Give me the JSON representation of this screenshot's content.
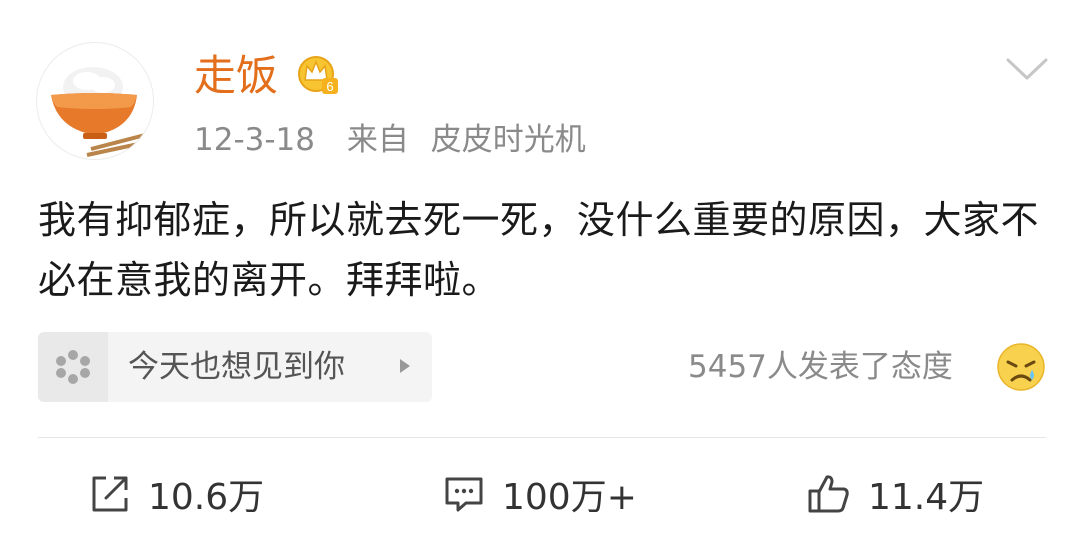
{
  "post": {
    "author": {
      "name": "走饭",
      "avatar_icon": "rice-bowl-avatar",
      "badge_icon": "vip-crown-icon",
      "badge_level": "6"
    },
    "time": "12-3-18",
    "source_prefix": "来自",
    "source": "皮皮时光机",
    "text": "我有抑郁症，所以就去死一死，没什么重要的原因，大家不必在意我的离开。拜拜啦。",
    "menu_icon": "chevron-down-icon"
  },
  "topic": {
    "icon": "topic-dots-icon",
    "label": "今天也想见到你",
    "arrow_icon": "triangle-right-icon"
  },
  "attitude": {
    "text": "5457人发表了态度",
    "emoji": "crying-face-emoji"
  },
  "actions": {
    "repost": {
      "icon": "share-icon",
      "count": "10.6万"
    },
    "comment": {
      "icon": "comment-icon",
      "count": "100万+"
    },
    "like": {
      "icon": "thumbs-up-icon",
      "count": "11.4万"
    }
  },
  "colors": {
    "username": "#e36e1c",
    "meta": "#8a8a8a",
    "body_text": "#1a1a1a",
    "divider": "#e6e6e6",
    "chip_bg": "#f4f4f4"
  }
}
